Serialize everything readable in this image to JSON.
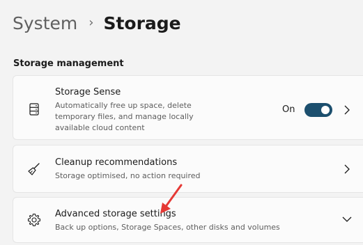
{
  "header": {
    "parent": "System",
    "separator": "›",
    "current": "Storage"
  },
  "section": {
    "title": "Storage management"
  },
  "cards": [
    {
      "title": "Storage Sense",
      "description": "Automatically free up space, delete temporary files, and manage locally available cloud content",
      "icon": "storage-drive-icon",
      "toggle": {
        "label": "On",
        "state": true,
        "color": "#1c4f6e"
      }
    },
    {
      "title": "Cleanup recommendations",
      "description": "Storage optimised, no action required",
      "icon": "broom-icon"
    },
    {
      "title": "Advanced storage settings",
      "description": "Back up options, Storage Spaces, other disks and volumes",
      "icon": "gear-icon"
    }
  ],
  "annotation": {
    "color": "#e53935"
  }
}
